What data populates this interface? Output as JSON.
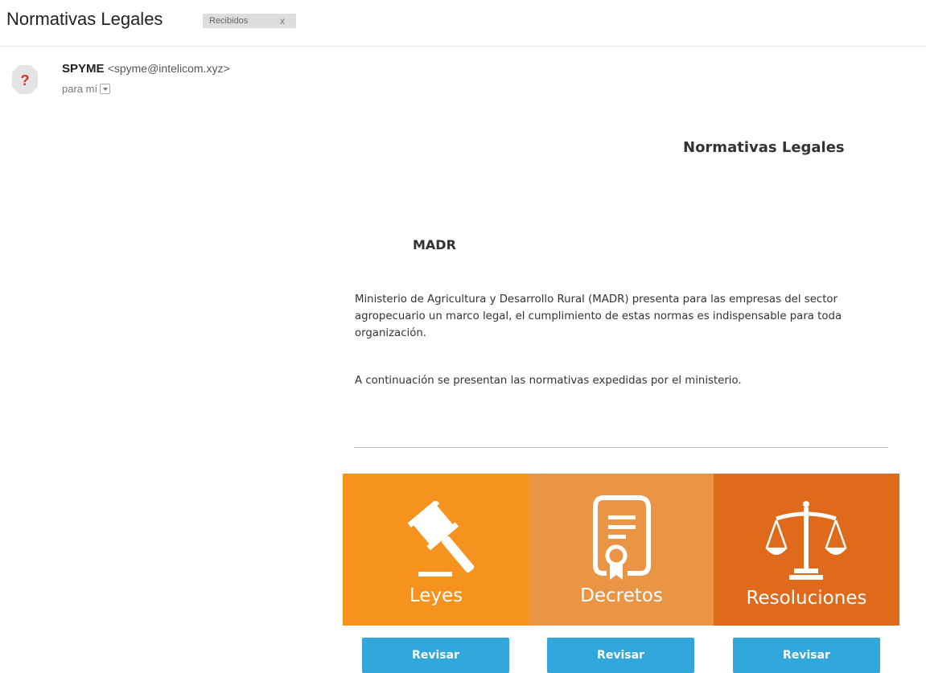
{
  "email": {
    "subject": "Normativas Legales",
    "label": "Recibidos",
    "label_close": "x",
    "sender_name": "SPYME",
    "sender_email": "<spyme@intelicom.xyz>",
    "recipient": "para mí",
    "avatar_glyph": "?"
  },
  "body": {
    "title": "Normativas Legales",
    "org": "MADR",
    "intro": "Ministerio de Agricultura y Desarrollo Rural (MADR) presenta para las empresas del sector agropecuario un marco legal, el cumplimiento de estas normas es indispensable para toda organización.",
    "intro2": "A continuación se presentan las normativas expedidas por el ministerio."
  },
  "tiles": [
    {
      "label": "Leyes",
      "icon": "gavel-icon",
      "color": "#f6921e",
      "button": "Revisar"
    },
    {
      "label": "Decretos",
      "icon": "document-certificate-icon",
      "color": "#e99545",
      "button": "Revisar"
    },
    {
      "label": "Resoluciones",
      "icon": "scales-icon",
      "color": "#e06a1c",
      "button": "Revisar"
    }
  ],
  "colors": {
    "button": "#31a7db"
  }
}
